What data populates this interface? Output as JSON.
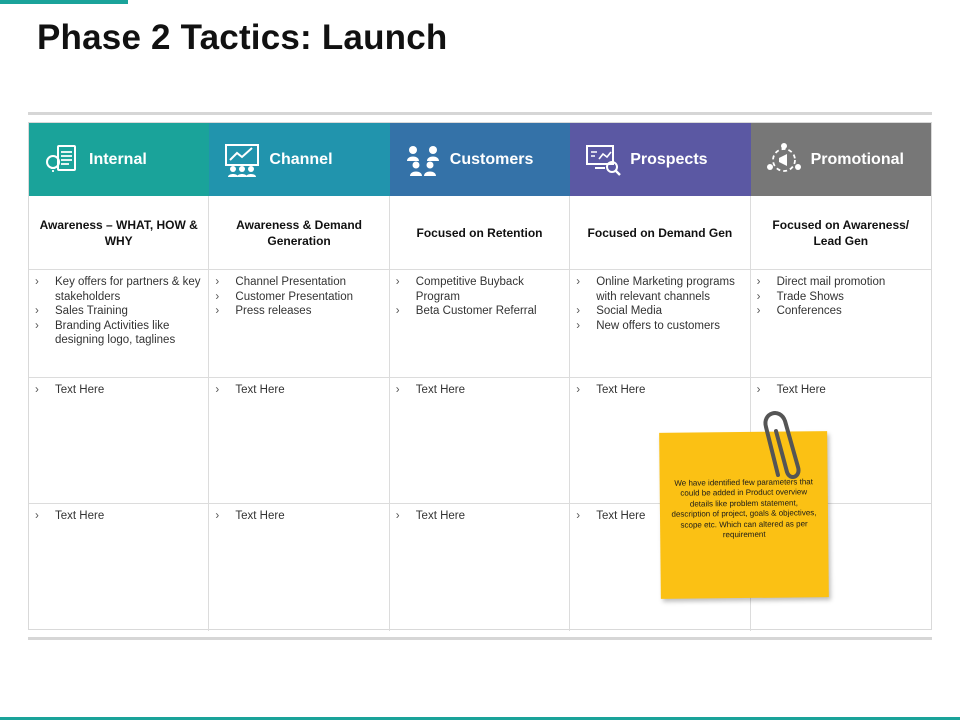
{
  "page": {
    "title": "Phase 2 Tactics: Launch"
  },
  "colors": {
    "accent": "#1aa39a",
    "internal": "#1aa39a",
    "channel": "#2194ad",
    "customers": "#3472a8",
    "prospects": "#5b58a3",
    "promotional": "#777777",
    "sticky": "#fbc114"
  },
  "columns": [
    {
      "id": "internal",
      "label": "Internal",
      "icon": "document-bulb-icon",
      "subheading": "Awareness – WHAT, HOW & WHY",
      "row1": [
        "Key offers for partners & key stakeholders",
        "Sales Training",
        "Branding Activities like designing logo, taglines"
      ],
      "row2": [
        "Text Here"
      ],
      "row3": [
        "Text Here"
      ]
    },
    {
      "id": "channel",
      "label": "Channel",
      "icon": "chart-people-icon",
      "subheading": "Awareness & Demand Generation",
      "row1": [
        "Channel Presentation",
        "Customer Presentation",
        "Press releases"
      ],
      "row2": [
        "Text Here"
      ],
      "row3": [
        "Text Here"
      ]
    },
    {
      "id": "customers",
      "label": "Customers",
      "icon": "people-group-icon",
      "subheading": "Focused on Retention",
      "row1": [
        "Competitive Buyback Program",
        "Beta Customer Referral"
      ],
      "row2": [
        "Text Here"
      ],
      "row3": [
        "Text Here"
      ]
    },
    {
      "id": "prospects",
      "label": "Prospects",
      "icon": "monitor-search-icon",
      "subheading": "Focused on Demand Gen",
      "row1": [
        "Online Marketing programs with relevant channels",
        "Social Media",
        "New offers to customers"
      ],
      "row2": [
        "Text Here"
      ],
      "row3": [
        "Text Here"
      ]
    },
    {
      "id": "promotional",
      "label": "Promotional",
      "icon": "megaphone-people-icon",
      "subheading": "Focused on Awareness/ Lead Gen",
      "row1": [
        "Direct mail promotion",
        "Trade Shows",
        "Conferences"
      ],
      "row2": [
        "Text Here"
      ],
      "row3": [
        "Text Here"
      ]
    }
  ],
  "bullet_glyph": "›",
  "sticky_note": {
    "text": "We have identified few parameters that could be added in Product overview details like problem statement, description of project, goals & objectives, scope etc. Which can altered as per requirement"
  }
}
